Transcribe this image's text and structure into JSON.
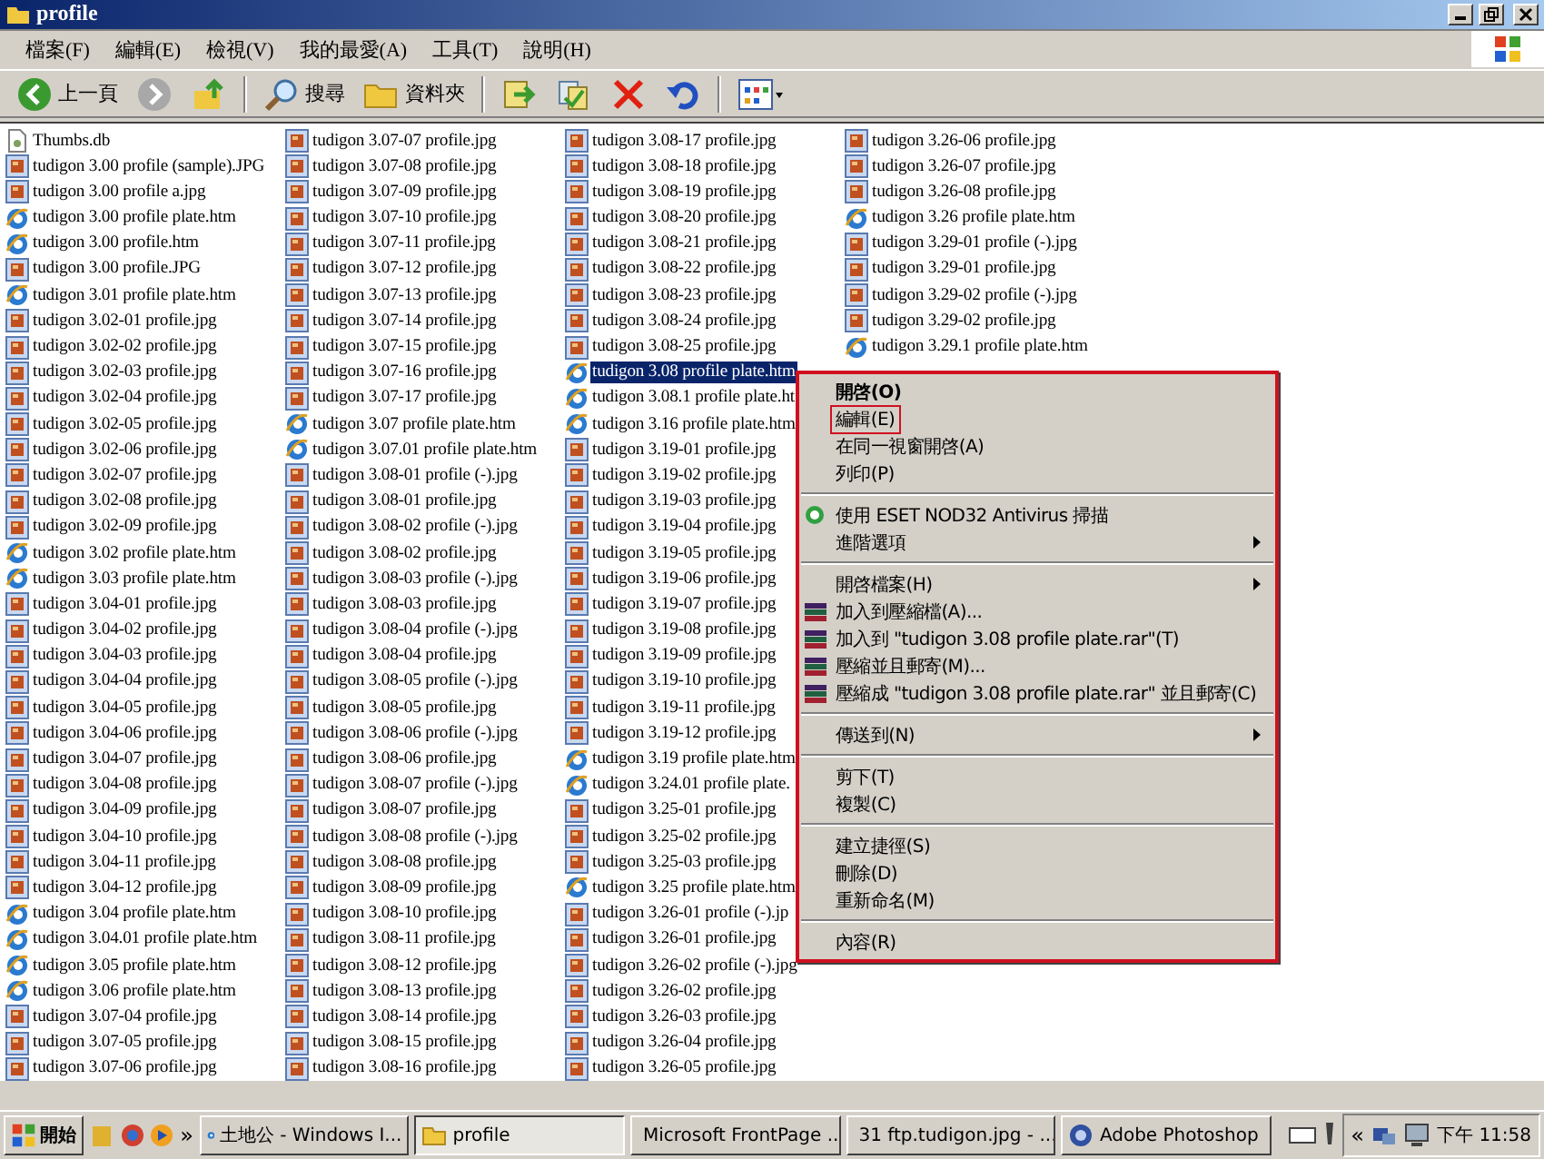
{
  "window": {
    "title": "profile"
  },
  "menu_bar": [
    "檔案(F)",
    "編輯(E)",
    "檢視(V)",
    "我的最愛(A)",
    "工具(T)",
    "說明(H)"
  ],
  "toolbar": [
    {
      "kind": "back",
      "label": "上一頁"
    },
    {
      "kind": "forward"
    },
    {
      "kind": "up"
    },
    {
      "kind": "search",
      "label": "搜尋"
    },
    {
      "kind": "folders",
      "label": "資料夾"
    },
    {
      "kind": "move"
    },
    {
      "kind": "copy"
    },
    {
      "kind": "delete"
    },
    {
      "kind": "undo"
    },
    {
      "kind": "views"
    }
  ],
  "files": [
    [
      {
        "name": "Thumbs.db",
        "kind": "db",
        "selected": false
      },
      {
        "name": "tudigon 3.00 profile (sample).JPG",
        "kind": "jpg",
        "selected": false
      },
      {
        "name": "tudigon 3.00 profile a.jpg",
        "kind": "jpg",
        "selected": false
      },
      {
        "name": "tudigon 3.00 profile plate.htm",
        "kind": "htm",
        "selected": false
      },
      {
        "name": "tudigon 3.00 profile.htm",
        "kind": "htm",
        "selected": false
      },
      {
        "name": "tudigon 3.00 profile.JPG",
        "kind": "jpg",
        "selected": false
      },
      {
        "name": "tudigon 3.01 profile plate.htm",
        "kind": "htm",
        "selected": false
      },
      {
        "name": "tudigon 3.02-01 profile.jpg",
        "kind": "jpg",
        "selected": false
      },
      {
        "name": "tudigon 3.02-02 profile.jpg",
        "kind": "jpg",
        "selected": false
      },
      {
        "name": "tudigon 3.02-03 profile.jpg",
        "kind": "jpg",
        "selected": false
      },
      {
        "name": "tudigon 3.02-04 profile.jpg",
        "kind": "jpg",
        "selected": false
      },
      {
        "name": "tudigon 3.02-05 profile.jpg",
        "kind": "jpg",
        "selected": false
      },
      {
        "name": "tudigon 3.02-06 profile.jpg",
        "kind": "jpg",
        "selected": false
      },
      {
        "name": "tudigon 3.02-07 profile.jpg",
        "kind": "jpg",
        "selected": false
      },
      {
        "name": "tudigon 3.02-08 profile.jpg",
        "kind": "jpg",
        "selected": false
      },
      {
        "name": "tudigon 3.02-09 profile.jpg",
        "kind": "jpg",
        "selected": false
      },
      {
        "name": "tudigon 3.02 profile plate.htm",
        "kind": "htm",
        "selected": false
      },
      {
        "name": "tudigon 3.03 profile plate.htm",
        "kind": "htm",
        "selected": false
      },
      {
        "name": "tudigon 3.04-01 profile.jpg",
        "kind": "jpg",
        "selected": false
      },
      {
        "name": "tudigon 3.04-02 profile.jpg",
        "kind": "jpg",
        "selected": false
      },
      {
        "name": "tudigon 3.04-03 profile.jpg",
        "kind": "jpg",
        "selected": false
      },
      {
        "name": "tudigon 3.04-04 profile.jpg",
        "kind": "jpg",
        "selected": false
      },
      {
        "name": "tudigon 3.04-05 profile.jpg",
        "kind": "jpg",
        "selected": false
      },
      {
        "name": "tudigon 3.04-06 profile.jpg",
        "kind": "jpg",
        "selected": false
      },
      {
        "name": "tudigon 3.04-07 profile.jpg",
        "kind": "jpg",
        "selected": false
      },
      {
        "name": "tudigon 3.04-08 profile.jpg",
        "kind": "jpg",
        "selected": false
      },
      {
        "name": "tudigon 3.04-09 profile.jpg",
        "kind": "jpg",
        "selected": false
      },
      {
        "name": "tudigon 3.04-10 profile.jpg",
        "kind": "jpg",
        "selected": false
      },
      {
        "name": "tudigon 3.04-11 profile.jpg",
        "kind": "jpg",
        "selected": false
      },
      {
        "name": "tudigon 3.04-12 profile.jpg",
        "kind": "jpg",
        "selected": false
      },
      {
        "name": "tudigon 3.04 profile plate.htm",
        "kind": "htm",
        "selected": false
      },
      {
        "name": "tudigon 3.04.01 profile plate.htm",
        "kind": "htm",
        "selected": false
      },
      {
        "name": "tudigon 3.05 profile plate.htm",
        "kind": "htm",
        "selected": false
      },
      {
        "name": "tudigon 3.06 profile plate.htm",
        "kind": "htm",
        "selected": false
      },
      {
        "name": "tudigon 3.07-04 profile.jpg",
        "kind": "jpg",
        "selected": false
      },
      {
        "name": "tudigon 3.07-05 profile.jpg",
        "kind": "jpg",
        "selected": false
      },
      {
        "name": "tudigon 3.07-06 profile.jpg",
        "kind": "jpg",
        "selected": false
      }
    ],
    [
      {
        "name": "tudigon 3.07-07 profile.jpg",
        "kind": "jpg",
        "selected": false
      },
      {
        "name": "tudigon 3.07-08 profile.jpg",
        "kind": "jpg",
        "selected": false
      },
      {
        "name": "tudigon 3.07-09 profile.jpg",
        "kind": "jpg",
        "selected": false
      },
      {
        "name": "tudigon 3.07-10 profile.jpg",
        "kind": "jpg",
        "selected": false
      },
      {
        "name": "tudigon 3.07-11 profile.jpg",
        "kind": "jpg",
        "selected": false
      },
      {
        "name": "tudigon 3.07-12 profile.jpg",
        "kind": "jpg",
        "selected": false
      },
      {
        "name": "tudigon 3.07-13 profile.jpg",
        "kind": "jpg",
        "selected": false
      },
      {
        "name": "tudigon 3.07-14 profile.jpg",
        "kind": "jpg",
        "selected": false
      },
      {
        "name": "tudigon 3.07-15 profile.jpg",
        "kind": "jpg",
        "selected": false
      },
      {
        "name": "tudigon 3.07-16 profile.jpg",
        "kind": "jpg",
        "selected": false
      },
      {
        "name": "tudigon 3.07-17 profile.jpg",
        "kind": "jpg",
        "selected": false
      },
      {
        "name": "tudigon 3.07 profile plate.htm",
        "kind": "htm",
        "selected": false
      },
      {
        "name": "tudigon 3.07.01 profile plate.htm",
        "kind": "htm",
        "selected": false
      },
      {
        "name": "tudigon 3.08-01 profile (-).jpg",
        "kind": "jpg",
        "selected": false
      },
      {
        "name": "tudigon 3.08-01 profile.jpg",
        "kind": "jpg",
        "selected": false
      },
      {
        "name": "tudigon 3.08-02 profile (-).jpg",
        "kind": "jpg",
        "selected": false
      },
      {
        "name": "tudigon 3.08-02 profile.jpg",
        "kind": "jpg",
        "selected": false
      },
      {
        "name": "tudigon 3.08-03 profile (-).jpg",
        "kind": "jpg",
        "selected": false
      },
      {
        "name": "tudigon 3.08-03 profile.jpg",
        "kind": "jpg",
        "selected": false
      },
      {
        "name": "tudigon 3.08-04 profile (-).jpg",
        "kind": "jpg",
        "selected": false
      },
      {
        "name": "tudigon 3.08-04 profile.jpg",
        "kind": "jpg",
        "selected": false
      },
      {
        "name": "tudigon 3.08-05 profile (-).jpg",
        "kind": "jpg",
        "selected": false
      },
      {
        "name": "tudigon 3.08-05 profile.jpg",
        "kind": "jpg",
        "selected": false
      },
      {
        "name": "tudigon 3.08-06 profile (-).jpg",
        "kind": "jpg",
        "selected": false
      },
      {
        "name": "tudigon 3.08-06 profile.jpg",
        "kind": "jpg",
        "selected": false
      },
      {
        "name": "tudigon 3.08-07 profile (-).jpg",
        "kind": "jpg",
        "selected": false
      },
      {
        "name": "tudigon 3.08-07 profile.jpg",
        "kind": "jpg",
        "selected": false
      },
      {
        "name": "tudigon 3.08-08 profile (-).jpg",
        "kind": "jpg",
        "selected": false
      },
      {
        "name": "tudigon 3.08-08 profile.jpg",
        "kind": "jpg",
        "selected": false
      },
      {
        "name": "tudigon 3.08-09 profile.jpg",
        "kind": "jpg",
        "selected": false
      },
      {
        "name": "tudigon 3.08-10 profile.jpg",
        "kind": "jpg",
        "selected": false
      },
      {
        "name": "tudigon 3.08-11 profile.jpg",
        "kind": "jpg",
        "selected": false
      },
      {
        "name": "tudigon 3.08-12 profile.jpg",
        "kind": "jpg",
        "selected": false
      },
      {
        "name": "tudigon 3.08-13 profile.jpg",
        "kind": "jpg",
        "selected": false
      },
      {
        "name": "tudigon 3.08-14 profile.jpg",
        "kind": "jpg",
        "selected": false
      },
      {
        "name": "tudigon 3.08-15 profile.jpg",
        "kind": "jpg",
        "selected": false
      },
      {
        "name": "tudigon 3.08-16 profile.jpg",
        "kind": "jpg",
        "selected": false
      }
    ],
    [
      {
        "name": "tudigon 3.08-17 profile.jpg",
        "kind": "jpg",
        "selected": false
      },
      {
        "name": "tudigon 3.08-18 profile.jpg",
        "kind": "jpg",
        "selected": false
      },
      {
        "name": "tudigon 3.08-19 profile.jpg",
        "kind": "jpg",
        "selected": false
      },
      {
        "name": "tudigon 3.08-20 profile.jpg",
        "kind": "jpg",
        "selected": false
      },
      {
        "name": "tudigon 3.08-21 profile.jpg",
        "kind": "jpg",
        "selected": false
      },
      {
        "name": "tudigon 3.08-22 profile.jpg",
        "kind": "jpg",
        "selected": false
      },
      {
        "name": "tudigon 3.08-23 profile.jpg",
        "kind": "jpg",
        "selected": false
      },
      {
        "name": "tudigon 3.08-24 profile.jpg",
        "kind": "jpg",
        "selected": false
      },
      {
        "name": "tudigon 3.08-25 profile.jpg",
        "kind": "jpg",
        "selected": false
      },
      {
        "name": "tudigon 3.08 profile plate.htm",
        "kind": "htm",
        "selected": true
      },
      {
        "name": "tudigon 3.08.1 profile plate.ht",
        "kind": "htm",
        "selected": false
      },
      {
        "name": "tudigon 3.16 profile plate.htm",
        "kind": "htm",
        "selected": false
      },
      {
        "name": "tudigon 3.19-01 profile.jpg",
        "kind": "jpg",
        "selected": false
      },
      {
        "name": "tudigon 3.19-02 profile.jpg",
        "kind": "jpg",
        "selected": false
      },
      {
        "name": "tudigon 3.19-03 profile.jpg",
        "kind": "jpg",
        "selected": false
      },
      {
        "name": "tudigon 3.19-04 profile.jpg",
        "kind": "jpg",
        "selected": false
      },
      {
        "name": "tudigon 3.19-05 profile.jpg",
        "kind": "jpg",
        "selected": false
      },
      {
        "name": "tudigon 3.19-06 profile.jpg",
        "kind": "jpg",
        "selected": false
      },
      {
        "name": "tudigon 3.19-07 profile.jpg",
        "kind": "jpg",
        "selected": false
      },
      {
        "name": "tudigon 3.19-08 profile.jpg",
        "kind": "jpg",
        "selected": false
      },
      {
        "name": "tudigon 3.19-09 profile.jpg",
        "kind": "jpg",
        "selected": false
      },
      {
        "name": "tudigon 3.19-10 profile.jpg",
        "kind": "jpg",
        "selected": false
      },
      {
        "name": "tudigon 3.19-11 profile.jpg",
        "kind": "jpg",
        "selected": false
      },
      {
        "name": "tudigon 3.19-12 profile.jpg",
        "kind": "jpg",
        "selected": false
      },
      {
        "name": "tudigon 3.19 profile plate.htm",
        "kind": "htm",
        "selected": false
      },
      {
        "name": "tudigon 3.24.01 profile plate.",
        "kind": "htm",
        "selected": false
      },
      {
        "name": "tudigon 3.25-01 profile.jpg",
        "kind": "jpg",
        "selected": false
      },
      {
        "name": "tudigon 3.25-02 profile.jpg",
        "kind": "jpg",
        "selected": false
      },
      {
        "name": "tudigon 3.25-03 profile.jpg",
        "kind": "jpg",
        "selected": false
      },
      {
        "name": "tudigon 3.25 profile plate.htm",
        "kind": "htm",
        "selected": false
      },
      {
        "name": "tudigon 3.26-01 profile (-).jp",
        "kind": "jpg",
        "selected": false
      },
      {
        "name": "tudigon 3.26-01 profile.jpg",
        "kind": "jpg",
        "selected": false
      },
      {
        "name": "tudigon 3.26-02 profile (-).jpg",
        "kind": "jpg",
        "selected": false
      },
      {
        "name": "tudigon 3.26-02 profile.jpg",
        "kind": "jpg",
        "selected": false
      },
      {
        "name": "tudigon 3.26-03 profile.jpg",
        "kind": "jpg",
        "selected": false
      },
      {
        "name": "tudigon 3.26-04 profile.jpg",
        "kind": "jpg",
        "selected": false
      },
      {
        "name": "tudigon 3.26-05 profile.jpg",
        "kind": "jpg",
        "selected": false
      }
    ],
    [
      {
        "name": "tudigon 3.26-06 profile.jpg",
        "kind": "jpg",
        "selected": false
      },
      {
        "name": "tudigon 3.26-07 profile.jpg",
        "kind": "jpg",
        "selected": false
      },
      {
        "name": "tudigon 3.26-08 profile.jpg",
        "kind": "jpg",
        "selected": false
      },
      {
        "name": "tudigon 3.26 profile plate.htm",
        "kind": "htm",
        "selected": false
      },
      {
        "name": "tudigon 3.29-01 profile (-).jpg",
        "kind": "jpg",
        "selected": false
      },
      {
        "name": "tudigon 3.29-01 profile.jpg",
        "kind": "jpg",
        "selected": false
      },
      {
        "name": "tudigon 3.29-02 profile (-).jpg",
        "kind": "jpg",
        "selected": false
      },
      {
        "name": "tudigon 3.29-02 profile.jpg",
        "kind": "jpg",
        "selected": false
      },
      {
        "name": "tudigon 3.29.1 profile plate.htm",
        "kind": "htm",
        "selected": false
      }
    ]
  ],
  "context_menu": [
    {
      "kind": "command",
      "label": "開啓(O)",
      "default": true
    },
    {
      "kind": "command",
      "label": "編輯(E)",
      "outlined": true
    },
    {
      "kind": "command",
      "label": "在同一視窗開啓(A)"
    },
    {
      "kind": "command",
      "label": "列印(P)"
    },
    {
      "kind": "separator"
    },
    {
      "kind": "scan",
      "label": "使用 ESET NOD32 Antivirus 掃描"
    },
    {
      "kind": "command",
      "label": "進階選項",
      "submenu": true
    },
    {
      "kind": "separator"
    },
    {
      "kind": "command",
      "label": "開啓檔案(H)",
      "submenu": true
    },
    {
      "kind": "archive",
      "label": "加入到壓縮檔(A)..."
    },
    {
      "kind": "archive",
      "label": "加入到 \"tudigon 3.08 profile plate.rar\"(T)"
    },
    {
      "kind": "archive",
      "label": "壓縮並且郵寄(M)..."
    },
    {
      "kind": "archive",
      "label": "壓縮成 \"tudigon 3.08 profile plate.rar\" 並且郵寄(C)"
    },
    {
      "kind": "separator"
    },
    {
      "kind": "command",
      "label": "傳送到(N)",
      "submenu": true
    },
    {
      "kind": "separator"
    },
    {
      "kind": "command",
      "label": "剪下(T)"
    },
    {
      "kind": "command",
      "label": "複製(C)"
    },
    {
      "kind": "separator"
    },
    {
      "kind": "command",
      "label": "建立捷徑(S)"
    },
    {
      "kind": "command",
      "label": "刪除(D)"
    },
    {
      "kind": "command",
      "label": "重新命名(M)"
    },
    {
      "kind": "separator"
    },
    {
      "kind": "command",
      "label": "內容(R)"
    }
  ],
  "taskbar": {
    "start": "開始",
    "more": "»",
    "tasks": [
      {
        "label": "土地公 - Windows I...",
        "kind": "ie",
        "selected": false
      },
      {
        "label": "profile",
        "kind": "folder",
        "selected": true
      },
      {
        "label": "Microsoft FrontPage ...",
        "kind": "frontpage",
        "selected": false
      },
      {
        "label": "31 ftp.tudigon.jpg - ...",
        "kind": "image",
        "selected": false
      },
      {
        "label": "Adobe Photoshop",
        "kind": "photoshop",
        "selected": false
      }
    ],
    "tray_toggle": "«",
    "clock": "下午 11:58"
  }
}
